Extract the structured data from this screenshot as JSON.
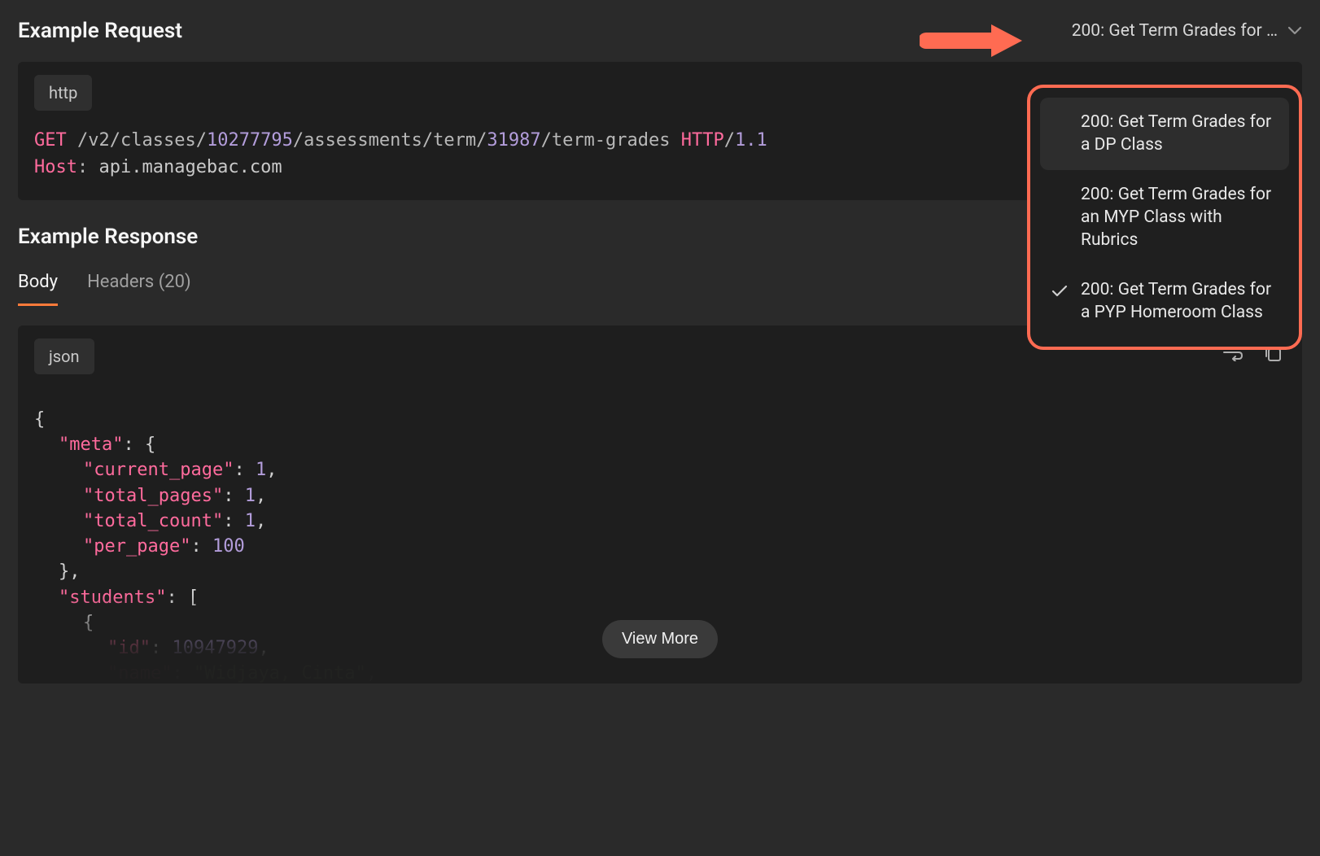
{
  "request": {
    "heading": "Example Request",
    "dropdown_selected": "200: Get Term Grades for …",
    "dropdown_options": [
      {
        "label": "200: Get Term Grades for a DP Class",
        "highlighted": true,
        "checked": false
      },
      {
        "label": "200: Get Term Grades for an MYP Class with Rubrics",
        "highlighted": false,
        "checked": false
      },
      {
        "label": "200: Get Term Grades for a PYP Homeroom Class",
        "highlighted": false,
        "checked": true
      }
    ],
    "lang_tag": "http",
    "http": {
      "method": "GET",
      "path_seg1": "/v2/classes/",
      "class_id": "10277795",
      "path_seg2": "/assessments/term/",
      "term_id": "31987",
      "path_seg3": "/term-grades",
      "proto_name": "HTTP",
      "proto_ver": "1.1",
      "host_header": "Host",
      "host_value": "api.managebac.com"
    }
  },
  "response": {
    "heading": "Example Response",
    "tabs": {
      "body": "Body",
      "headers": "Headers (20)"
    },
    "lang_tag": "json",
    "view_more": "View More",
    "json_keys": {
      "meta": "meta",
      "current_page": "current_page",
      "total_pages": "total_pages",
      "total_count": "total_count",
      "per_page": "per_page",
      "students": "students",
      "id": "id",
      "name": "name"
    },
    "json_vals": {
      "current_page": "1",
      "total_pages": "1",
      "total_count": "1",
      "per_page": "100",
      "student_id": "10947929",
      "student_name": "Widjaya, Cinta"
    }
  }
}
